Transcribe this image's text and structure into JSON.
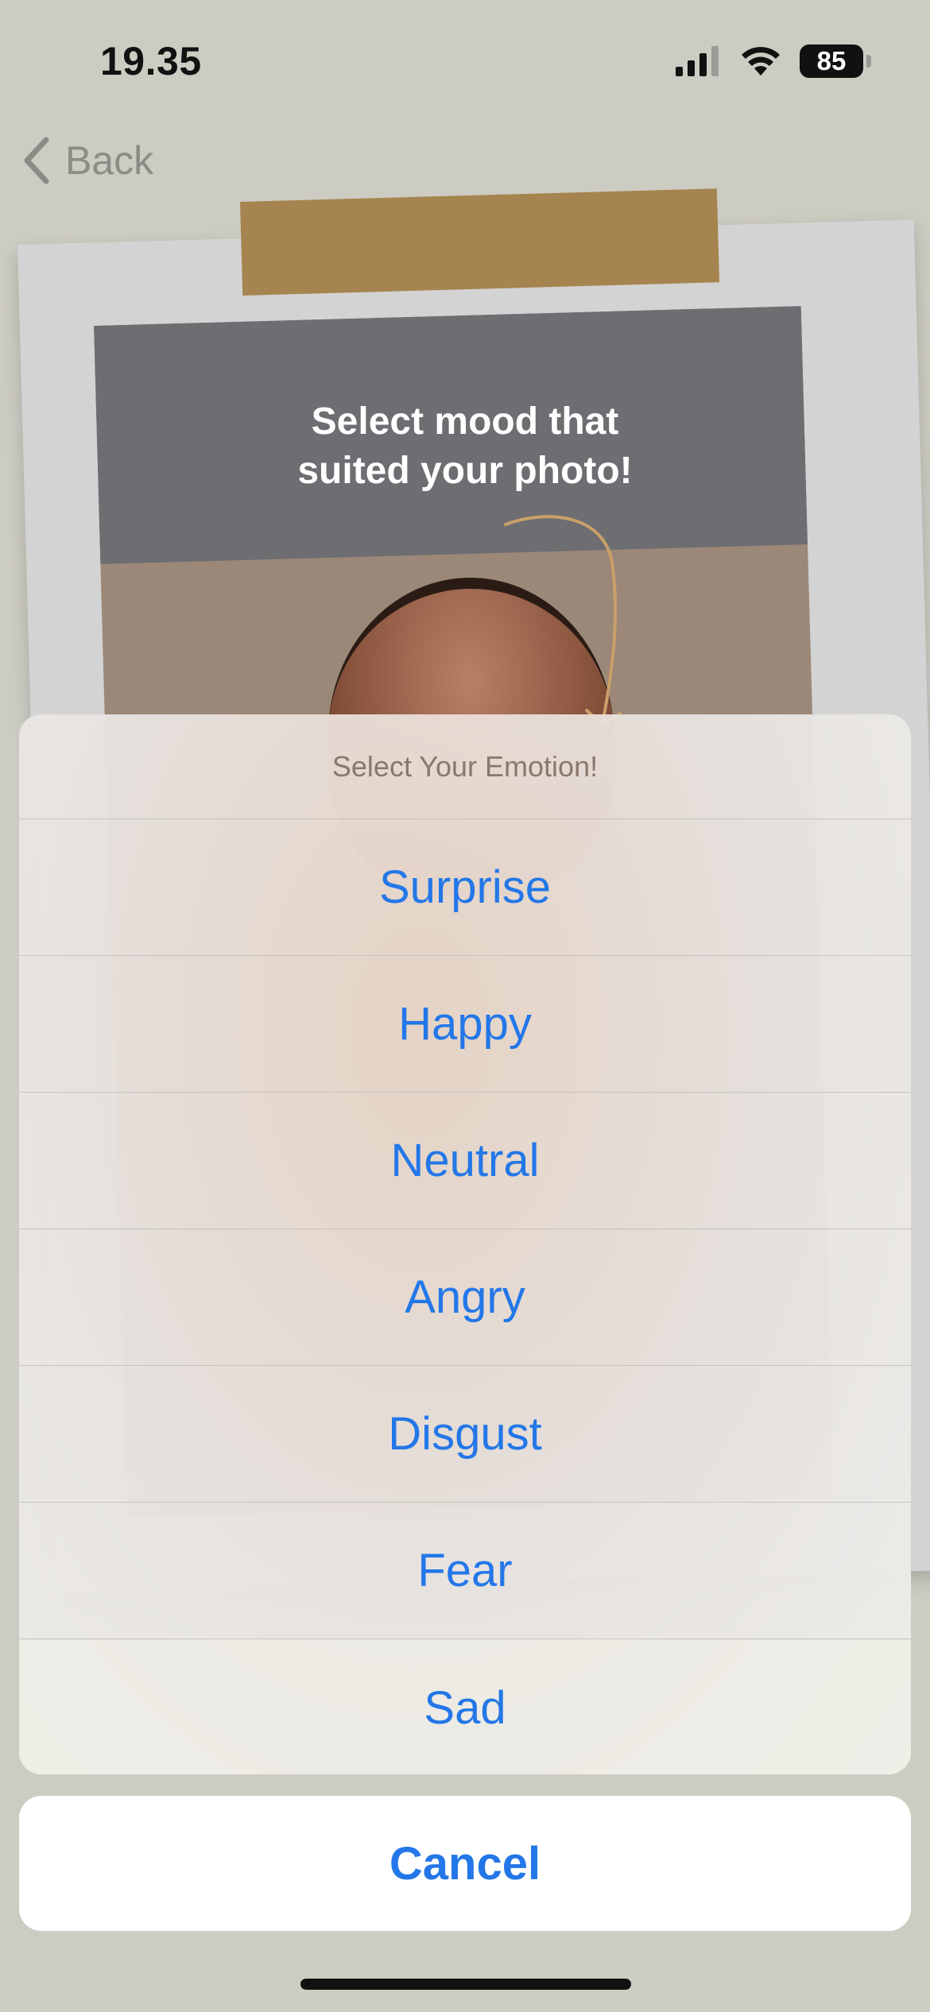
{
  "status_bar": {
    "time": "19.35",
    "battery": "85"
  },
  "nav": {
    "back_label": "Back"
  },
  "photo_card": {
    "title_line1": "Select mood that",
    "title_line2": "suited your photo!"
  },
  "action_sheet": {
    "title": "Select Your Emotion!",
    "options": [
      "Surprise",
      "Happy",
      "Neutral",
      "Angry",
      "Disgust",
      "Fear",
      "Sad"
    ],
    "cancel_label": "Cancel"
  },
  "colors": {
    "accent": "#2377e8",
    "tape": "#a5844f",
    "background": "#cdccc3"
  }
}
